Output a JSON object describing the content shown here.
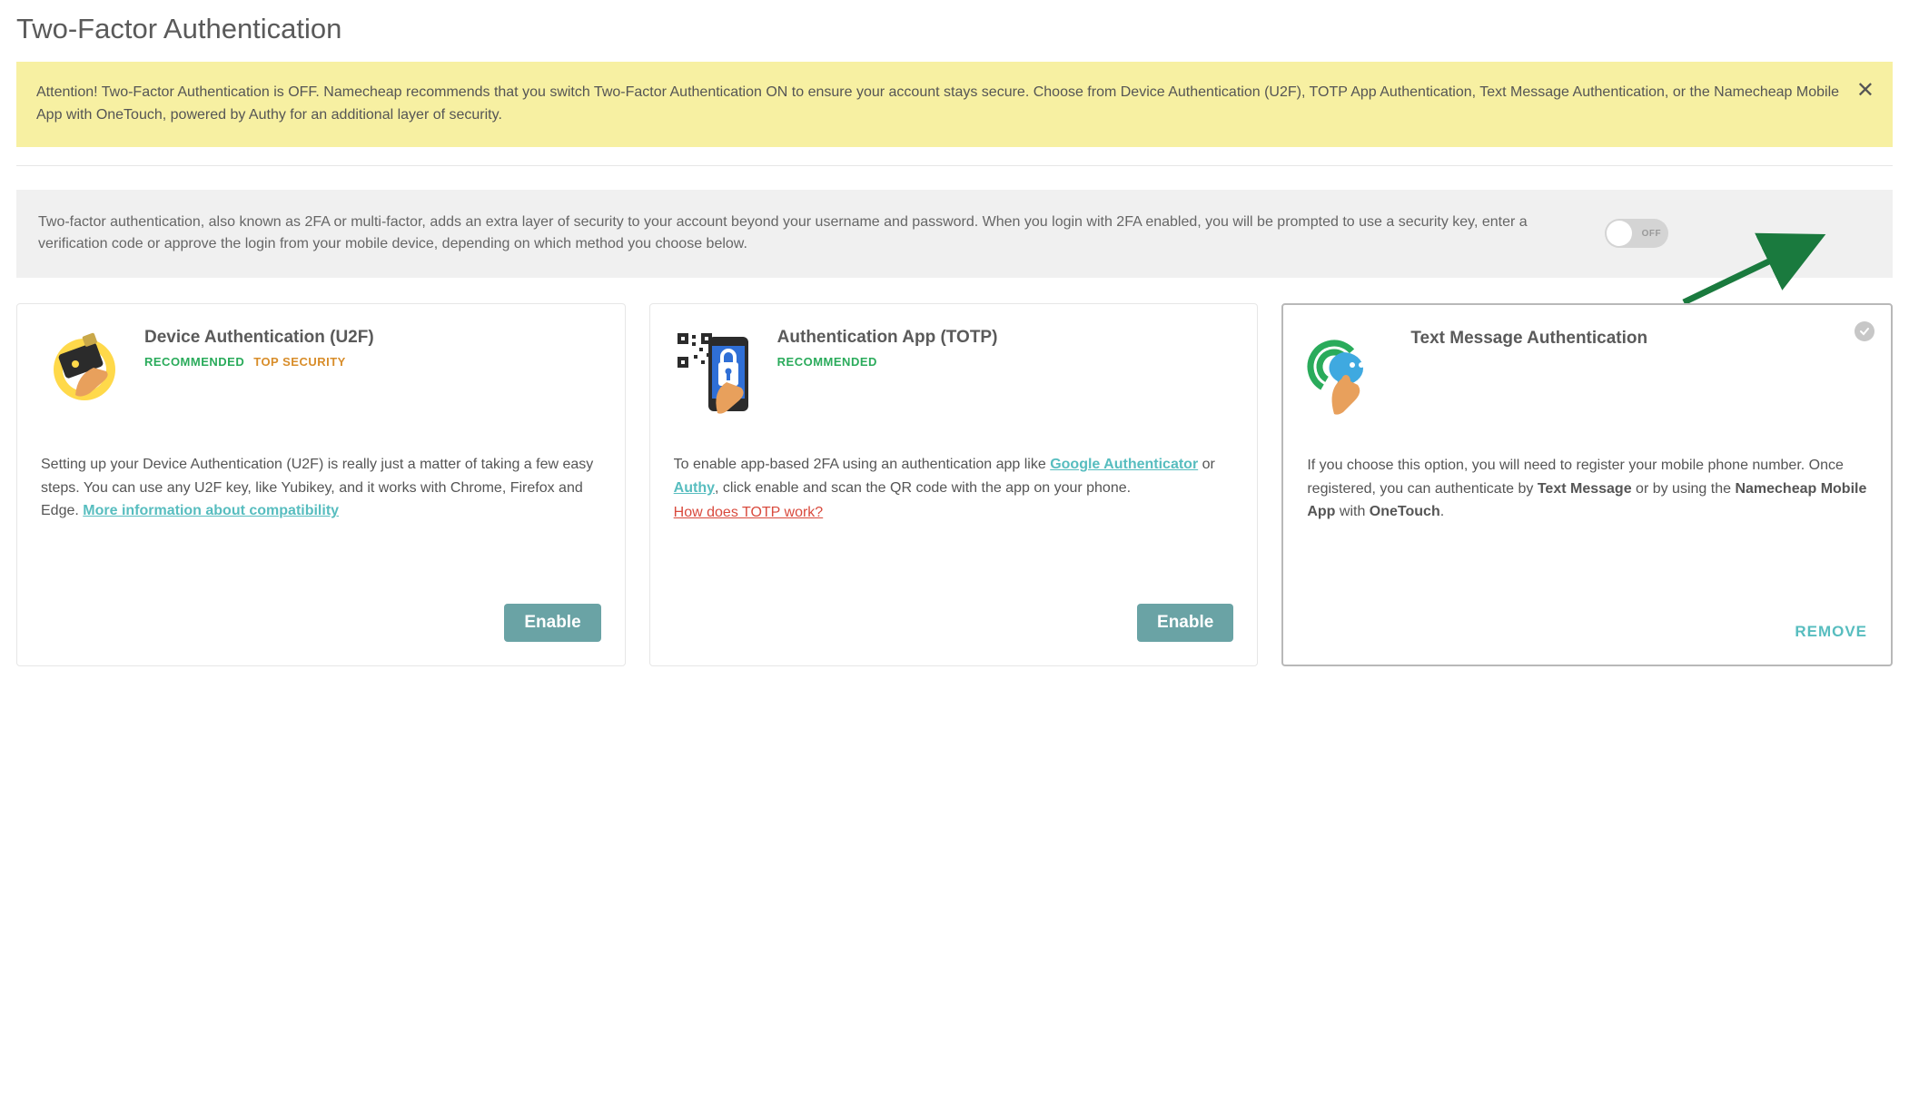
{
  "pageTitle": "Two-Factor Authentication",
  "alert": {
    "text": "Attention! Two-Factor Authentication is OFF. Namecheap recommends that you switch Two-Factor Authentication ON to ensure your account stays secure. Choose from Device Authentication (U2F), TOTP App Authentication, Text Message Authentication, or the Namecheap Mobile App with OneTouch, powered by Authy for an additional layer of security."
  },
  "info": {
    "text": "Two-factor authentication, also known as 2FA or multi-factor, adds an extra layer of security to your account beyond your username and password. When you login with 2FA enabled, you will be prompted to use a security key, enter a verification code or approve the login from your mobile device, depending on which method you choose below.",
    "toggleState": "OFF"
  },
  "cards": {
    "u2f": {
      "title": "Device Authentication (U2F)",
      "badgeRec": "RECOMMENDED",
      "badgeTop": "TOP SECURITY",
      "bodyPre": "Setting up your Device Authentication (U2F) is really just a matter of taking a few easy steps. You can use any U2F key, like Yubikey, and it works with Chrome, Firefox and Edge. ",
      "moreLink": "More information about compatibility",
      "enable": "Enable"
    },
    "totp": {
      "title": "Authentication App (TOTP)",
      "badgeRec": "RECOMMENDED",
      "bodyPre": "To enable app-based 2FA using an authentication app like ",
      "linkGA": "Google Authenticator",
      "bodyMid": " or ",
      "linkAuthy": "Authy",
      "bodyPost": ", click enable and scan the QR code with the app on your phone.",
      "howLink": "How does TOTP work?",
      "enable": "Enable"
    },
    "sms": {
      "title": "Text Message Authentication",
      "bodyPre": "If you choose this option, you will need to register your mobile phone number. Once registered, you can authenticate by ",
      "bold1": "Text Message",
      "bodyMid1": " or by using the ",
      "bold2": "Namecheap Mobile App",
      "bodyMid2": " with ",
      "bold3": "OneTouch",
      "bodyEnd": ".",
      "remove": "REMOVE"
    }
  }
}
